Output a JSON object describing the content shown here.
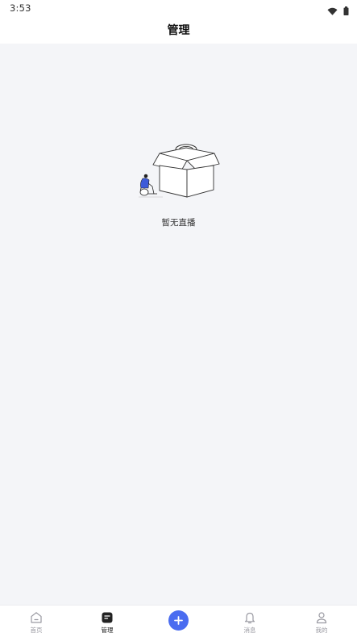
{
  "status_bar": {
    "time": "3:53",
    "icons": [
      "wifi-icon",
      "battery-icon"
    ]
  },
  "header": {
    "title": "管理"
  },
  "empty_state": {
    "illustration": "empty-box-illustration",
    "message": "暂无直播",
    "accent_color": "#3d5bd9"
  },
  "tab_bar": {
    "items": [
      {
        "label": "首页",
        "icon": "home-icon",
        "active": false
      },
      {
        "label": "管理",
        "icon": "manage-icon",
        "active": true
      },
      {
        "label": "",
        "icon": "plus-icon",
        "active": false
      },
      {
        "label": "消息",
        "icon": "bell-icon",
        "active": false
      },
      {
        "label": "我的",
        "icon": "user-icon",
        "active": false
      }
    ],
    "add_button_color": "#4a6cf0"
  }
}
